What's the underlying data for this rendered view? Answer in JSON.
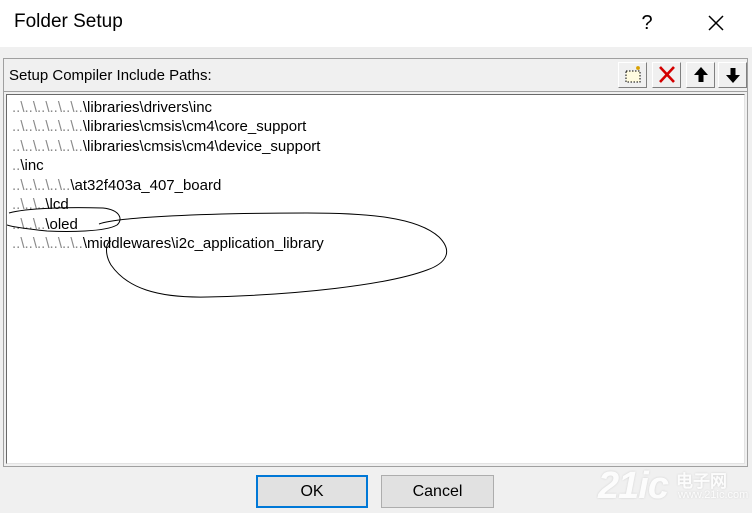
{
  "window": {
    "title": "Folder Setup",
    "help_label": "?"
  },
  "group": {
    "label": "Setup Compiler Include Paths:"
  },
  "toolbar": {
    "icons": [
      "new-folder-icon",
      "delete-icon",
      "move-up-icon",
      "move-down-icon"
    ]
  },
  "paths": {
    "items": [
      {
        "prefix": "..\\..\\..\\..\\..\\..",
        "rest": "\\libraries\\drivers\\inc"
      },
      {
        "prefix": "..\\..\\..\\..\\..\\..",
        "rest": "\\libraries\\cmsis\\cm4\\core_support"
      },
      {
        "prefix": "..\\..\\..\\..\\..\\..",
        "rest": "\\libraries\\cmsis\\cm4\\device_support"
      },
      {
        "prefix": "..",
        "rest": "\\inc"
      },
      {
        "prefix": "..\\..\\..\\..\\..",
        "rest": "\\at32f403a_407_board"
      },
      {
        "prefix": "..\\..\\..",
        "rest": "\\lcd"
      },
      {
        "prefix": "..\\..\\..",
        "rest": "\\oled"
      },
      {
        "prefix": "..\\..\\..\\..\\..\\..",
        "rest": "\\middlewares\\i2c_application_library"
      }
    ]
  },
  "buttons": {
    "ok": "OK",
    "cancel": "Cancel"
  },
  "watermark": {
    "main": "21ic",
    "cn": "电子网",
    "url": "www.21ic.com"
  },
  "colors": {
    "focus_border": "#0078d7",
    "delete_icon": "#d40000",
    "annotation_stroke": "#000000"
  }
}
